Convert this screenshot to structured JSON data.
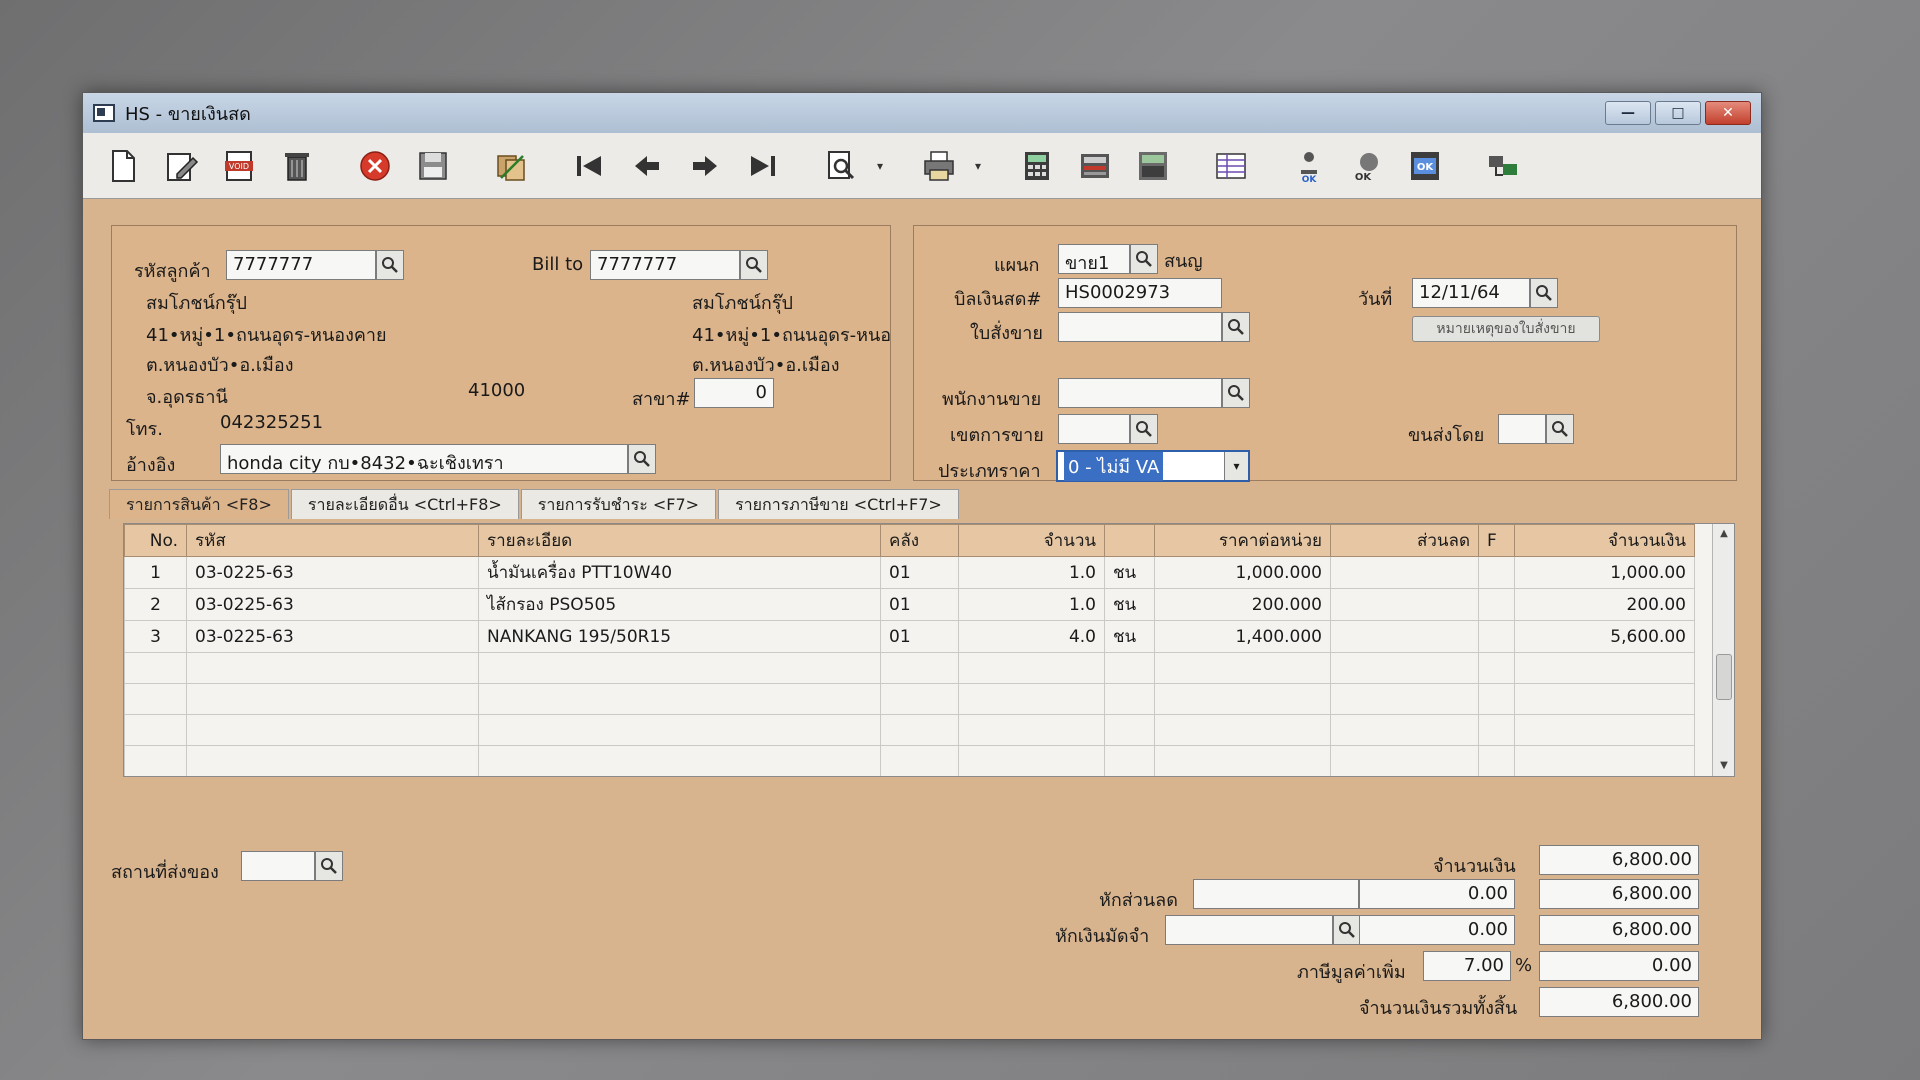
{
  "window": {
    "title": "HS - ขายเงินสด",
    "min": "—",
    "max": "□",
    "close": "✕"
  },
  "toolbar": {
    "icons": [
      "new-document-icon",
      "edit-icon",
      "void-icon",
      "delete-trash-icon",
      "cancel-icon",
      "save-icon",
      "copy-transfer-icon",
      "first-record-icon",
      "previous-record-icon",
      "next-record-icon",
      "last-record-icon",
      "search-document-icon",
      "printer-icon",
      "calculator-icon",
      "register-icon",
      "balance-icon",
      "report-icon",
      "approve-icon",
      "pay-icon",
      "ok-icon",
      "network-icon"
    ],
    "dropdown_arrow": "▾"
  },
  "customer": {
    "code_label": "รหัสลูกค้า",
    "code": "7777777",
    "name": "สมโภชน์กรุ๊ป",
    "addr1": "41•หมู่•1•ถนนอุดร-หนองคาย",
    "addr2": "ต.หนองบัว•อ.เมือง",
    "addr3": "จ.อุดรธานี",
    "zip": "41000",
    "phone_label": "โทร.",
    "phone": "042325251",
    "ref_label": "อ้างอิง",
    "ref": "honda city กบ•8432•ฉะเชิงเทรา",
    "billto_label": "Bill to",
    "billto_code": "7777777",
    "billto_name": "สมโภชน์กรุ๊ป",
    "billto_addr1": "41•หมู่•1•ถนนอุดร-หนอ",
    "billto_addr2": "ต.หนองบัว•อ.เมือง",
    "branch_label": "สาขา#",
    "branch": "0"
  },
  "doc": {
    "dept_label": "แผนก",
    "dept": "ขาย1",
    "dept_name": "สนญ",
    "bill_label": "บิลเงินสด#",
    "bill_no": "HS0002973",
    "date_label": "วันที่",
    "date": "12/11/64",
    "so_label": "ใบสั่งขาย",
    "so": "",
    "so_note_button": "หมายเหตุของใบสั่งขาย",
    "salesman_label": "พนักงานขาย",
    "salesman": "",
    "area_label": "เขตการขาย",
    "area": "",
    "shipper_label": "ขนส่งโดย",
    "shipper": "",
    "price_type_label": "ประเภทราคา",
    "price_type": "0 - ไม่มี VA"
  },
  "tabs": [
    {
      "label": "รายการสินค้า <F8>"
    },
    {
      "label": "รายละเอียดอื่น <Ctrl+F8>"
    },
    {
      "label": "รายการรับชำระ <F7>"
    },
    {
      "label": "รายการภาษีขาย <Ctrl+F7>"
    }
  ],
  "grid": {
    "headers": [
      "No.",
      "รหัส",
      "รายละเอียด",
      "คลัง",
      "จำนวน",
      "",
      "ราคาต่อหน่วย",
      "ส่วนลด",
      "F",
      "จำนวนเงิน"
    ],
    "rows": [
      [
        "1",
        "03-0225-63",
        "น้ำมันเครื่อง PTT10W40",
        "01",
        "1.0",
        "ชน",
        "1,000.000",
        "",
        "",
        "1,000.00"
      ],
      [
        "2",
        "03-0225-63",
        "ไส้กรอง PSO505",
        "01",
        "1.0",
        "ชน",
        "200.000",
        "",
        "",
        "200.00"
      ],
      [
        "3",
        "03-0225-63",
        "NANKANG 195/50R15",
        "01",
        "4.0",
        "ชน",
        "1,400.000",
        "",
        "",
        "5,600.00"
      ],
      [
        "",
        "",
        "",
        "",
        "",
        "",
        "",
        "",
        "",
        ""
      ],
      [
        "",
        "",
        "",
        "",
        "",
        "",
        "",
        "",
        "",
        ""
      ],
      [
        "",
        "",
        "",
        "",
        "",
        "",
        "",
        "",
        "",
        ""
      ],
      [
        "",
        "",
        "",
        "",
        "",
        "",
        "",
        "",
        "",
        ""
      ]
    ]
  },
  "totals": {
    "ship_place_label": "สถานที่ส่งของ",
    "ship_place": "",
    "amount_label": "จำนวนเงิน",
    "amount": "6,800.00",
    "discount_label": "หักส่วนลด",
    "discount_text": "",
    "discount": "0.00",
    "after_discount": "6,800.00",
    "deposit_label": "หักเงินมัดจำ",
    "deposit_text": "",
    "deposit": "0.00",
    "after_deposit": "6,800.00",
    "vat_label": "ภาษีมูลค่าเพิ่ม",
    "vat_rate": "7.00",
    "vat_pct": "%",
    "vat_amount": "0.00",
    "grand_label": "จำนวนเงินรวมทั้งสิ้น",
    "grand_total": "6,800.00"
  }
}
